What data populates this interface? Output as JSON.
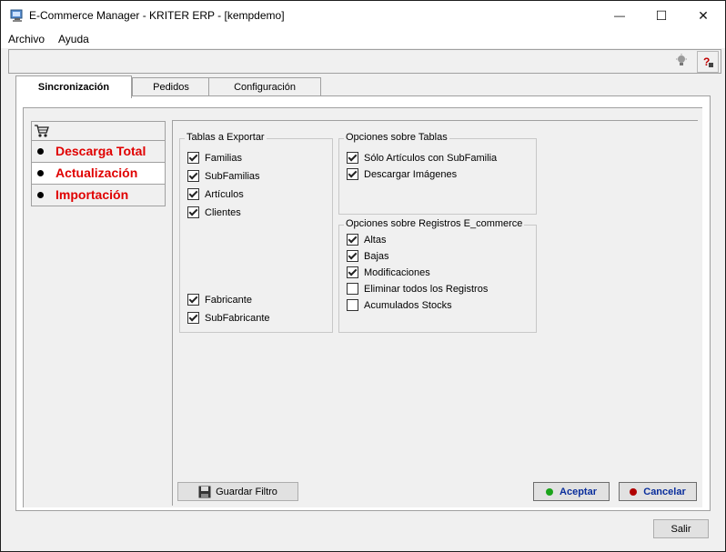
{
  "window": {
    "title": "E-Commerce Manager - KRITER ERP - [kempdemo]",
    "minimize": "—",
    "maximize": "☐",
    "close": "✕"
  },
  "menu": {
    "items": [
      "Archivo",
      "Ayuda"
    ]
  },
  "toolbar": {
    "icons": [
      "bulb-icon",
      "help-icon"
    ]
  },
  "tabs": [
    "Sincronización",
    "Pedidos",
    "Configuración"
  ],
  "nav": {
    "header_icon": "cart-icon",
    "items": [
      "Descarga Total",
      "Actualización",
      "Importación"
    ]
  },
  "tablas_exportar": {
    "title": "Tablas a Exportar",
    "items": [
      {
        "label": "Familias",
        "checked": true
      },
      {
        "label": "SubFamilias",
        "checked": true
      },
      {
        "label": "Artículos",
        "checked": true
      },
      {
        "label": "Clientes",
        "checked": true
      },
      {
        "label": "Fabricante",
        "checked": true
      },
      {
        "label": "SubFabricante",
        "checked": true
      }
    ]
  },
  "opciones_tablas": {
    "title": "Opciones sobre Tablas",
    "items": [
      {
        "label": "Sólo Artículos con SubFamilia",
        "checked": true
      },
      {
        "label": "Descargar Imágenes",
        "checked": true
      }
    ]
  },
  "opciones_registros": {
    "title": "Opciones sobre Registros E_commerce",
    "items": [
      {
        "label": "Altas",
        "checked": true
      },
      {
        "label": "Bajas",
        "checked": true
      },
      {
        "label": "Modificaciones",
        "checked": true
      },
      {
        "label": "Eliminar todos los Registros",
        "checked": false
      },
      {
        "label": "Acumulados Stocks",
        "checked": false
      }
    ]
  },
  "buttons": {
    "guardar": "Guardar Filtro",
    "aceptar": "Aceptar",
    "cancelar": "Cancelar",
    "salir": "Salir"
  },
  "colors": {
    "accent_red": "#e00000",
    "accept_green": "#1aa31a",
    "cancel_red": "#b00000",
    "button_text_blue": "#0a2e9c"
  }
}
